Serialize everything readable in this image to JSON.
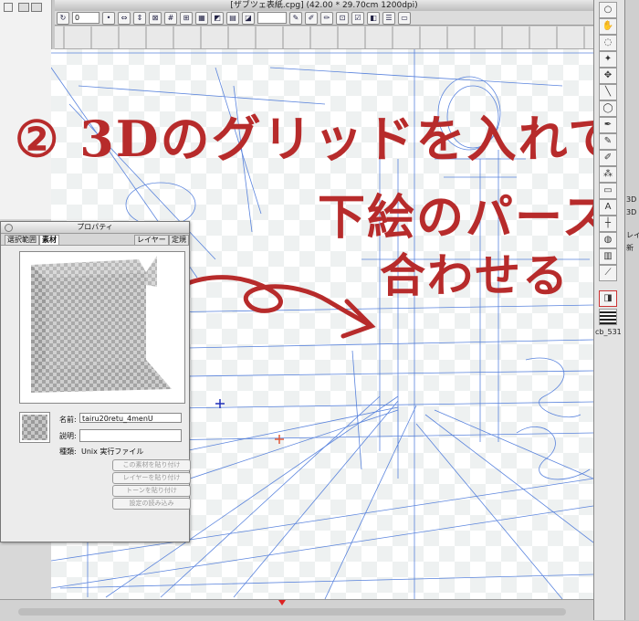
{
  "window": {
    "title": "[ザブツェ表紙.cpg] (42.00 * 29.70cm 1200dpi)"
  },
  "toolbar": {
    "angle_value": "0",
    "zoom_value": "",
    "icons": [
      "rotate-icon",
      "arrows-icon",
      "mirror-icon",
      "checkbox-icon",
      "grid-icon",
      "pen-icon",
      "brush-icon",
      "select-icon"
    ]
  },
  "annotations": {
    "line1": "② 3Dのグリッドを入れて",
    "line2": "下絵のパースに",
    "line3": "合わせる",
    "color": "#b72b2b"
  },
  "properties_panel": {
    "title": "プロパティ",
    "tabs": [
      "選択範囲",
      "素材",
      "レイヤー",
      "定規"
    ],
    "active_tab": "素材",
    "name_label": "名前:",
    "name_value": "tairu20retu_4menU",
    "description_label": "説明:",
    "description_value": "",
    "kind_label": "種類:",
    "kind_value": "Unix 実行ファイル",
    "buttons": [
      "この素材を貼り付け",
      "レイヤーを貼り付け",
      "トーンを貼り付け",
      "設定の読み込み"
    ]
  },
  "tool_palette": {
    "icons": [
      "magnifier-icon",
      "hand-icon",
      "lasso-icon",
      "wand-icon",
      "move-icon",
      "line-icon",
      "ellipse-icon",
      "pen-icon",
      "pencil-icon",
      "brush-icon",
      "airbrush-icon",
      "eraser-icon",
      "fill-icon",
      "gradient-icon",
      "text-icon",
      "ruler-icon",
      "eyedropper-icon"
    ],
    "swatch_label": "cb_531"
  },
  "side_panel": {
    "labels": [
      "3D",
      "3D",
      "レイ",
      "新"
    ]
  }
}
